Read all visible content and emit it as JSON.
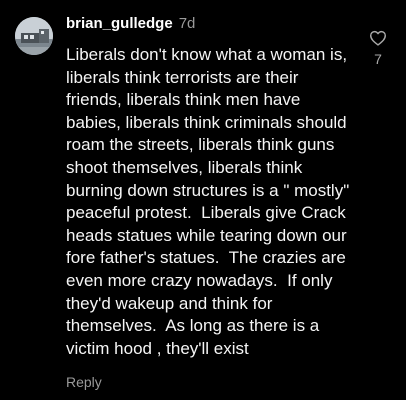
{
  "comment": {
    "username": "brian_gulledge",
    "time_ago": "7d",
    "text": "Liberals don't know what a woman is, liberals think terrorists are their friends, liberals think men have babies, liberals think criminals should roam the streets, liberals think guns shoot themselves, liberals think burning down structures is a \" mostly\" peaceful protest.  Liberals give Crack heads statues while tearing down our fore father's statues.  The crazies are even more crazy nowadays.  If only they'd wakeup and think for themselves.  As long as there is a victim hood , they'll exist",
    "reply_label": "Reply",
    "like_count": "7"
  },
  "icons": {
    "like": "heart-outline-icon",
    "avatar": "user-avatar-photo"
  },
  "colors": {
    "background": "#000000",
    "text": "#f5f5f5",
    "muted": "#9a9a9a"
  }
}
